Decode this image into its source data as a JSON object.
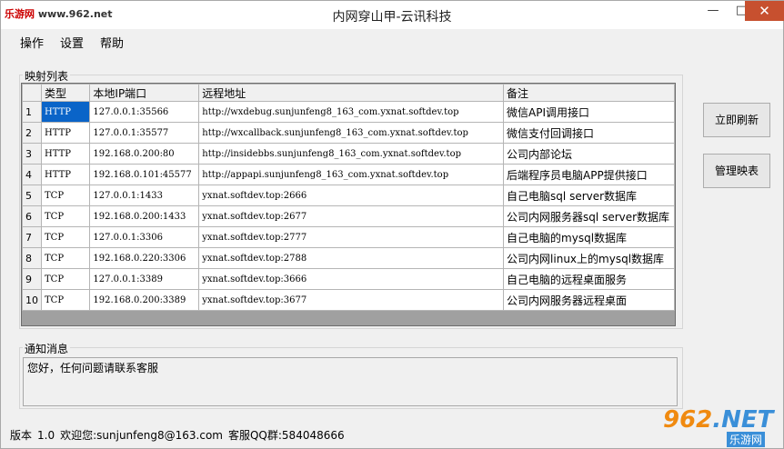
{
  "window": {
    "title": "内网穿山甲-云讯科技",
    "watermark_prefix": "乐游网",
    "watermark_url": "www.962.net",
    "min_glyph": "—",
    "max_glyph": "□",
    "close_glyph": "✕"
  },
  "menu": {
    "items": [
      "操作",
      "设置",
      "帮助"
    ]
  },
  "mapping": {
    "group_title": "映射列表",
    "columns": [
      "类型",
      "本地IP端口",
      "远程地址",
      "备注"
    ],
    "rows": [
      {
        "num": "1",
        "type": "HTTP",
        "local": "127.0.0.1:35566",
        "remote": "http://wxdebug.sunjunfeng8_163_com.yxnat.softdev.top",
        "note": "微信API调用接口"
      },
      {
        "num": "2",
        "type": "HTTP",
        "local": "127.0.0.1:35577",
        "remote": "http://wxcallback.sunjunfeng8_163_com.yxnat.softdev.top",
        "note": "微信支付回调接口"
      },
      {
        "num": "3",
        "type": "HTTP",
        "local": "192.168.0.200:80",
        "remote": "http://insidebbs.sunjunfeng8_163_com.yxnat.softdev.top",
        "note": "公司内部论坛"
      },
      {
        "num": "4",
        "type": "HTTP",
        "local": "192.168.0.101:45577",
        "remote": "http://appapi.sunjunfeng8_163_com.yxnat.softdev.top",
        "note": "后端程序员电脑APP提供接口"
      },
      {
        "num": "5",
        "type": "TCP",
        "local": "127.0.0.1:1433",
        "remote": "yxnat.softdev.top:2666",
        "note": "自己电脑sql server数据库"
      },
      {
        "num": "6",
        "type": "TCP",
        "local": "192.168.0.200:1433",
        "remote": "yxnat.softdev.top:2677",
        "note": "公司内网服务器sql server数据库"
      },
      {
        "num": "7",
        "type": "TCP",
        "local": "127.0.0.1:3306",
        "remote": "yxnat.softdev.top:2777",
        "note": "自己电脑的mysql数据库"
      },
      {
        "num": "8",
        "type": "TCP",
        "local": "192.168.0.220:3306",
        "remote": "yxnat.softdev.top:2788",
        "note": "公司内网linux上的mysql数据库"
      },
      {
        "num": "9",
        "type": "TCP",
        "local": "127.0.0.1:3389",
        "remote": "yxnat.softdev.top:3666",
        "note": "自己电脑的远程桌面服务"
      },
      {
        "num": "10",
        "type": "TCP",
        "local": "192.168.0.200:3389",
        "remote": "yxnat.softdev.top:3677",
        "note": "公司内网服务器远程桌面"
      }
    ]
  },
  "buttons": {
    "refresh": "立即刷新",
    "manage": "管理映表"
  },
  "notice": {
    "group_title": "通知消息",
    "text": "您好，任何问题请联系客服"
  },
  "status": {
    "version_label": "版本",
    "version": "1.0",
    "welcome": "欢迎您:sunjunfeng8@163.com",
    "qq_group": "客服QQ群:584048666"
  },
  "corner_logo": {
    "big_a": "962",
    "big_b": ".NET",
    "small": "乐游网"
  }
}
